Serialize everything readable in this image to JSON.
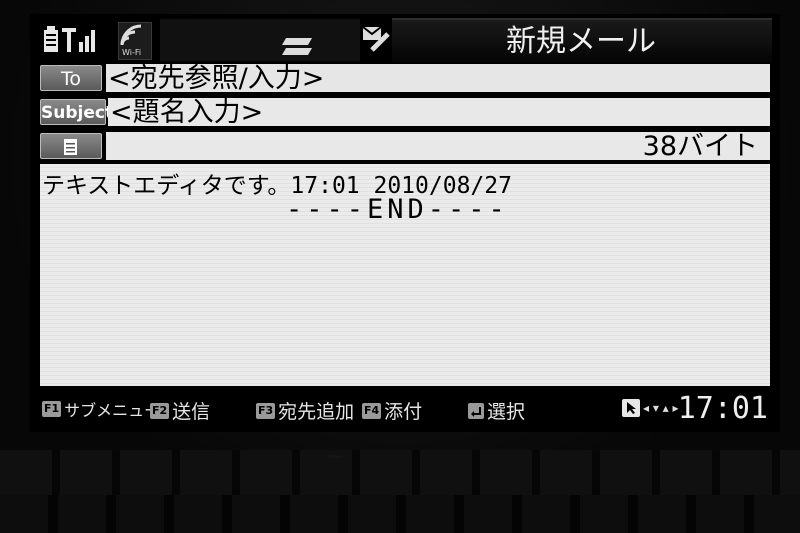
{
  "status_bar": {
    "wifi_label": "Wi-Fi",
    "title": "新規メール"
  },
  "header": {
    "to_button": "To",
    "to_value": "<宛先参照/入力>",
    "subject_button": "Subject",
    "subject_value": "<題名入力>",
    "size_value": "38バイト"
  },
  "body": {
    "line1": "テキストエディタです。17:01 2010/08/27",
    "end_marker": "----END----"
  },
  "function_bar": {
    "f1_key": "F1",
    "f1_label": "サブメニュー",
    "f2_key": "F2",
    "f2_label": "送信",
    "f3_key": "F3",
    "f3_label": "宛先追加",
    "f4_key": "F4",
    "f4_label": "添付",
    "enter_label": "選択",
    "clock": "17:01"
  },
  "colors": {
    "screen_bg": "#000000",
    "field_bg": "#e6e6e6",
    "button_bg": "#7a7a7a",
    "text_light": "#e6e6e6"
  },
  "icons": [
    "battery-icon",
    "signal-icon",
    "wifi-icon",
    "layers-icon",
    "mail-edit-icon",
    "memo-icon",
    "enter-icon",
    "cursor-icon"
  ]
}
